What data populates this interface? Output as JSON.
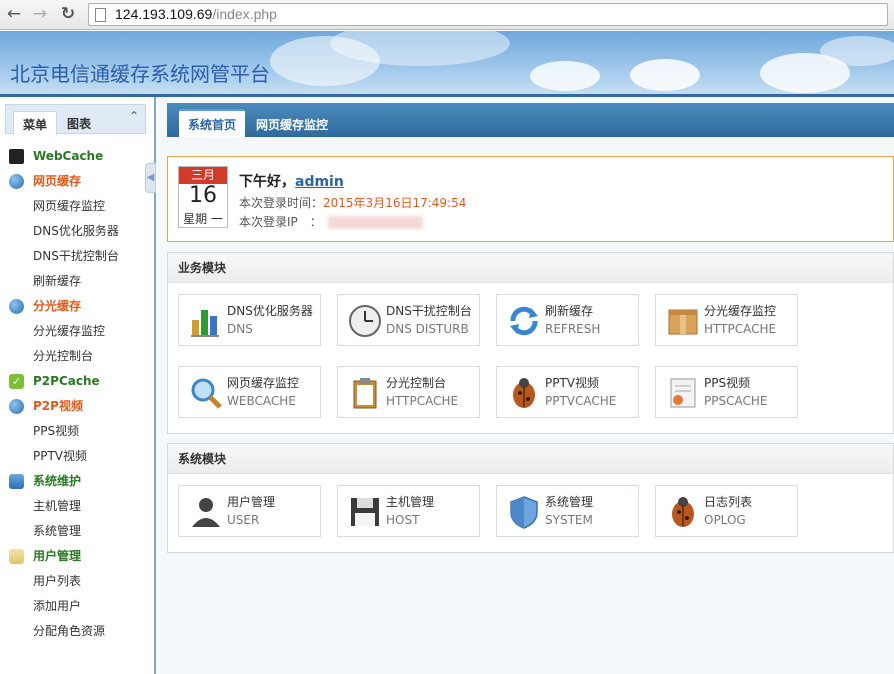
{
  "browser": {
    "url_host": "124.193.109.69",
    "url_path": "/index.php"
  },
  "header": {
    "title": "北京电信通缓存系统网管平台"
  },
  "sidebar": {
    "tabs": [
      "菜单",
      "图表"
    ],
    "collapse_label": "⌃",
    "menu": [
      {
        "type": "section",
        "label": "WebCache",
        "color": "#2a7a22",
        "icon": "webcache-icon"
      },
      {
        "type": "section",
        "label": "网页缓存",
        "color": "#e05a1a",
        "icon": "globe-icon"
      },
      {
        "type": "item",
        "label": "网页缓存监控"
      },
      {
        "type": "item",
        "label": "DNS优化服务器"
      },
      {
        "type": "item",
        "label": "DNS干扰控制台"
      },
      {
        "type": "item",
        "label": "刷新缓存"
      },
      {
        "type": "section",
        "label": "分光缓存",
        "color": "#e05a1a",
        "icon": "globe-icon"
      },
      {
        "type": "item",
        "label": "分光缓存监控"
      },
      {
        "type": "item",
        "label": "分光控制台"
      },
      {
        "type": "section",
        "label": "P2PCache",
        "color": "#2a7a22",
        "icon": "check-icon"
      },
      {
        "type": "section",
        "label": "P2P视频",
        "color": "#e05a1a",
        "icon": "globe-icon"
      },
      {
        "type": "item",
        "label": "PPS视频"
      },
      {
        "type": "item",
        "label": "PPTV视频"
      },
      {
        "type": "section",
        "label": "系统维护",
        "color": "#2a7a22",
        "icon": "user-settings-icon"
      },
      {
        "type": "item",
        "label": "主机管理"
      },
      {
        "type": "item",
        "label": "系统管理"
      },
      {
        "type": "section",
        "label": "用户管理",
        "color": "#2a7a22",
        "icon": "folder-icon"
      },
      {
        "type": "item",
        "label": "用户列表"
      },
      {
        "type": "item",
        "label": "添加用户"
      },
      {
        "type": "item",
        "label": "分配角色资源"
      }
    ]
  },
  "main": {
    "tabs": [
      "系统首页",
      "网页缓存监控"
    ],
    "welcome": {
      "cal_month": "三月",
      "cal_day": "16",
      "cal_week": "星期 一",
      "greeting": "下午好，",
      "user": "admin",
      "login_time_label": "本次登录时间：",
      "login_time": "2015年3月16日17:49:54",
      "login_ip_label": "本次登录IP　："
    },
    "business": {
      "title": "业务模块",
      "tiles": [
        {
          "name": "DNS优化服务器",
          "en": "DNS",
          "icon": "bar-chart-icon"
        },
        {
          "name": "DNS干扰控制台",
          "en": "DNS DISTURB",
          "icon": "clock-icon"
        },
        {
          "name": "刷新缓存",
          "en": "REFRESH",
          "icon": "refresh-icon"
        },
        {
          "name": "分光缓存监控",
          "en": "HTTPCACHE",
          "icon": "box-icon"
        },
        {
          "name": "网页缓存监控",
          "en": "WEBCACHE",
          "icon": "magnifier-icon"
        },
        {
          "name": "分光控制台",
          "en": "HTTPCACHE",
          "icon": "clipboard-icon"
        },
        {
          "name": "PPTV视频",
          "en": "PPTVCACHE",
          "icon": "bug-icon"
        },
        {
          "name": "PPS视频",
          "en": "PPSCACHE",
          "icon": "certificate-icon"
        }
      ]
    },
    "system": {
      "title": "系统模块",
      "tiles": [
        {
          "name": "用户管理",
          "en": "USER",
          "icon": "user-icon"
        },
        {
          "name": "主机管理",
          "en": "HOST",
          "icon": "floppy-icon"
        },
        {
          "name": "系统管理",
          "en": "SYSTEM",
          "icon": "shield-icon"
        },
        {
          "name": "日志列表",
          "en": "OPLOG",
          "icon": "bug-icon"
        }
      ]
    }
  }
}
